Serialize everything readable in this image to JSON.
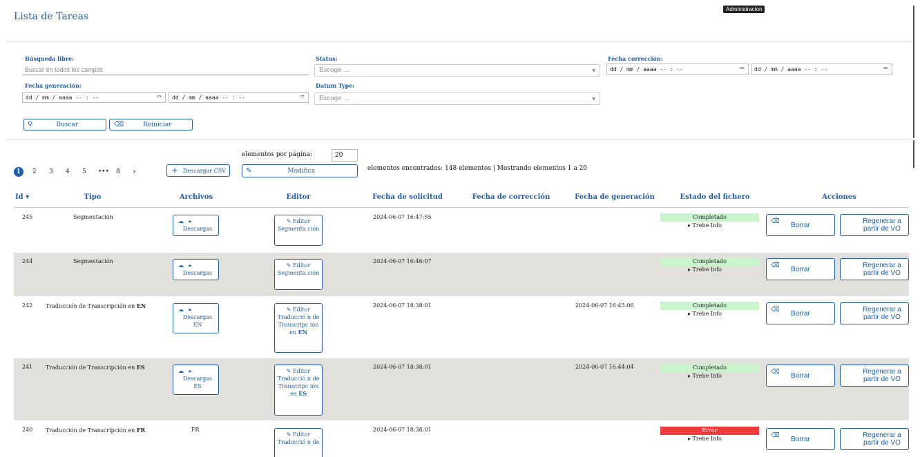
{
  "page": {
    "title": "Lista de Tareas",
    "tooltip": "Administracion"
  },
  "filters": {
    "libre_label": "Búsqueda libre:",
    "libre_placeholder": "Buscar en todos los campos",
    "status_label": "Status:",
    "status_placeholder": "Escoge ...",
    "fecha_correccion_label": "Fecha corrección:",
    "fecha_generacion_label": "Fecha generación:",
    "datum_label": "Datum Type:",
    "datum_placeholder": "Escoge ...",
    "date_placeholder": "dd / mm / aaaa   -- : --",
    "buscar": "Buscar",
    "reiniciar": "Reiniciar"
  },
  "pagination": {
    "pages": [
      "1",
      "2",
      "3",
      "4",
      "5",
      "•••",
      "8",
      "›"
    ]
  },
  "toolbar": {
    "descargar_csv": "Descargar CSV",
    "per_page_label": "elementos por página:",
    "per_page_value": "20",
    "modifica": "Modifica",
    "summary": "elementos encontrados: 148 elementos | Mostrando elementos 1 a 20"
  },
  "table": {
    "headers": {
      "id": "Id ▾",
      "tipo": "Tipo",
      "archivos": "Archivos",
      "editor": "Editor",
      "fecha_solicitud": "Fecha de solicitud",
      "fecha_correccion": "Fecha de corrección",
      "fecha_generacion": "Fecha de generación",
      "estado": "Estado del fichero",
      "acciones": "Acciones"
    },
    "trebe_label": "▸  Trebe Info",
    "borrar_label": "Borrar",
    "regenerar_label": "Regenerar a partir de VO",
    "rows": [
      {
        "id": "245",
        "tipo": "Segmentación",
        "descargas": "Descargas",
        "editor": "Editor Segmenta ción",
        "fecha_solicitud": "2024-06-07 16:47:55",
        "fecha_generacion": "",
        "estado": "Completado"
      },
      {
        "id": "244",
        "tipo": "Segmentación",
        "descargas": "Descargas",
        "editor": "Editor Segmenta ción",
        "fecha_solicitud": "2024-06-07 16:46:07",
        "fecha_generacion": "",
        "estado": "Completado"
      },
      {
        "id": "242",
        "tipo_prefix": "Traducción de Transcripción en",
        "tipo_lang": "EN",
        "descargas": "Descargas EN",
        "editor": "Editor Traducció n de Transcripc ión en",
        "editor_lang": "EN",
        "fecha_solicitud": "2024-06-07 18:38:01",
        "fecha_generacion": "2024-06-07 16:45:06",
        "estado": "Completado"
      },
      {
        "id": "241",
        "tipo_prefix": "Traducción de Transcripción en",
        "tipo_lang": "ES",
        "descargas": "Descargas ES",
        "editor": "Editor Traducció n de Transcripc ión en",
        "editor_lang": "ES",
        "fecha_solicitud": "2024-06-07 18:38:01",
        "fecha_generacion": "2024-06-07 16:44:04",
        "estado": "Completado"
      },
      {
        "id": "240",
        "tipo_prefix": "Traducción de Transcripción en",
        "tipo_lang": "FR",
        "archivos_text": "FR",
        "editor": "Editor Traducció n de",
        "fecha_solicitud": "2024-06-07 18:38:01",
        "fecha_generacion": "",
        "estado": "Error"
      }
    ]
  }
}
